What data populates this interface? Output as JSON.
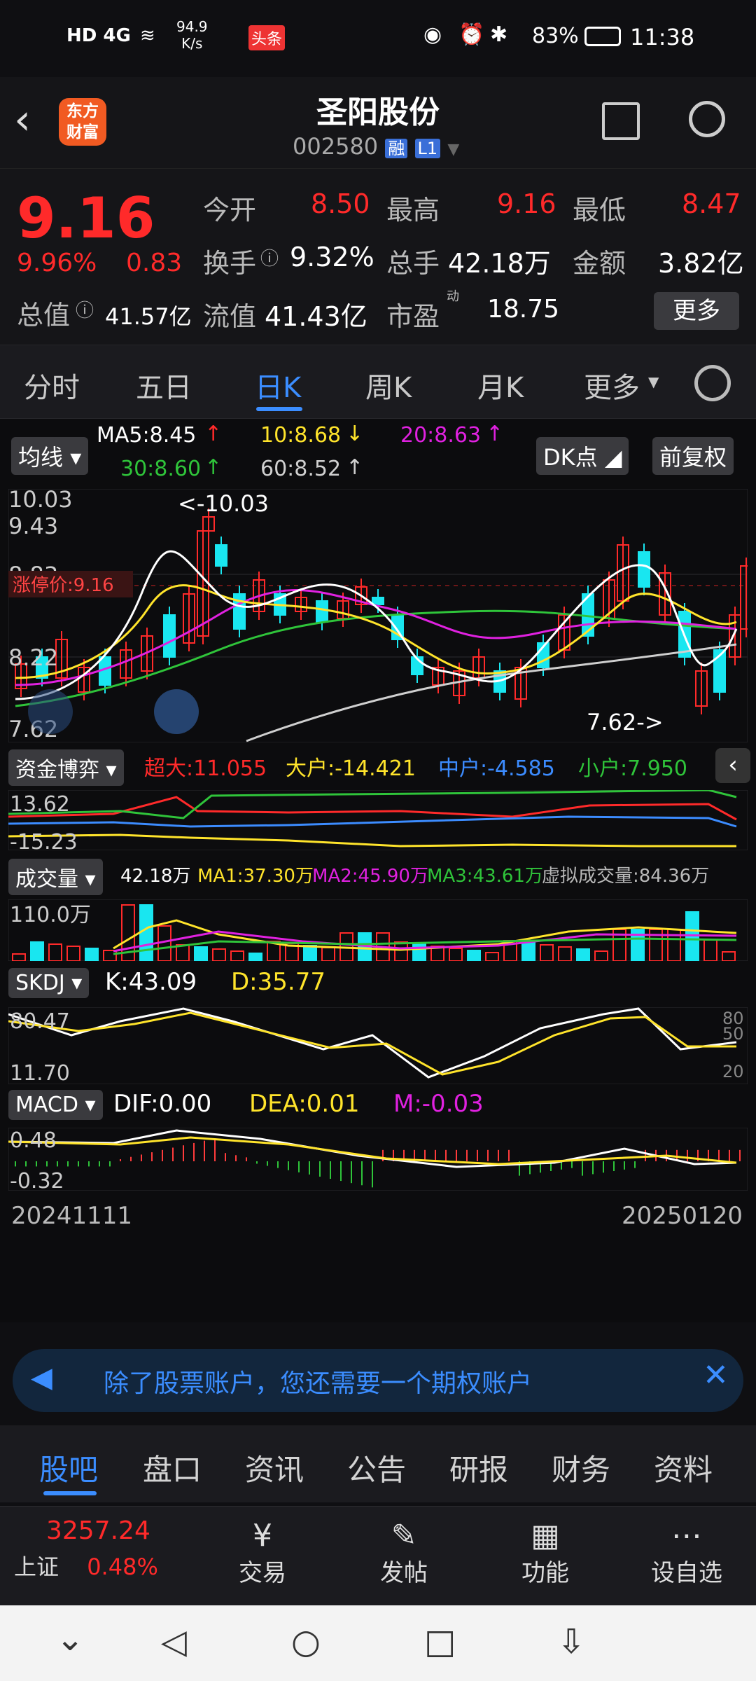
{
  "status_bar": {
    "network": "HD 4G",
    "speed": "94.9",
    "speed_unit": "K/s",
    "badge": "头条",
    "battery": "83%",
    "time": "11:38"
  },
  "header": {
    "app_logo": "东方财富",
    "title": "圣阳股份",
    "code": "002580",
    "tag1": "融",
    "tag2": "L1"
  },
  "quote": {
    "price": "9.16",
    "change_pct": "9.96%",
    "change": "0.83",
    "open_label": "今开",
    "open": "8.50",
    "high_label": "最高",
    "high": "9.16",
    "low_label": "最低",
    "low": "8.47",
    "turnover_label": "换手",
    "turnover": "9.32%",
    "volume_label": "总手",
    "volume": "42.18万",
    "amount_label": "金额",
    "amount": "3.82亿",
    "mktcap_label": "总值",
    "mktcap": "41.57亿",
    "float_label": "流值",
    "float": "41.43亿",
    "pe_label": "市盈",
    "pe_sup": "动",
    "pe": "18.75",
    "more_label": "更多"
  },
  "tabs": [
    "分时",
    "五日",
    "日K",
    "周K",
    "月K",
    "更多"
  ],
  "active_tab": "日K",
  "ma": {
    "label": "均线",
    "ma5": "MA5:8.45",
    "ma10": "10:8.68",
    "ma20": "20:8.63",
    "ma30": "30:8.60",
    "ma60": "60:8.52",
    "dk_label": "DK点",
    "fq_label": "前复权"
  },
  "kline": {
    "y_high": "10.03",
    "y_mid1": "9.43",
    "y_mid2": "8.83",
    "y_mid3": "8.22",
    "y_low": "7.62",
    "max_marker": "<-10.03",
    "min_marker": "7.62->",
    "limit_label": "涨停价:9.16"
  },
  "fund": {
    "label": "资金博弈",
    "super": "超大:11.055",
    "big": "大户:-14.421",
    "mid": "中户:-4.585",
    "small": "小户:7.950",
    "y_top": "13.62",
    "y_bottom": "-15.23"
  },
  "volume": {
    "label": "成交量",
    "vol": "42.18万",
    "ma1": "MA1:37.30万",
    "ma2": "MA2:45.90万",
    "ma3": "MA3:43.61万",
    "virtual": "虚拟成交量:84.36万",
    "y_top": "110.0万"
  },
  "skdj": {
    "label": "SKDJ",
    "k": "K:43.09",
    "d": "D:35.77",
    "y_top": "80.47",
    "y_bottom": "11.70",
    "r80": "80",
    "r50": "50",
    "r20": "20"
  },
  "macd": {
    "label": "MACD",
    "dif": "DIF:0.00",
    "dea": "DEA:0.01",
    "m": "M:-0.03",
    "y_top": "0.48",
    "y_bottom": "-0.32"
  },
  "dates": {
    "start": "20241111",
    "end": "20250120"
  },
  "banner": {
    "text": "除了股票账户，您还需要一个期权账户"
  },
  "subtabs": [
    "股吧",
    "盘口",
    "资讯",
    "公告",
    "研报",
    "财务",
    "资料"
  ],
  "bottom_nav": {
    "index_value": "3257.24",
    "index_name": "上证",
    "index_change": "0.48%",
    "items": [
      "交易",
      "发帖",
      "功能",
      "设自选"
    ]
  },
  "colors": {
    "up": "#ff2a2a",
    "down": "#19e6f0",
    "accent": "#3b8dff",
    "ma5": "#ffffff",
    "ma10": "#ffe42b",
    "ma20": "#e021e0",
    "ma30": "#2fc43a",
    "ma60": "#d0d0d0"
  }
}
